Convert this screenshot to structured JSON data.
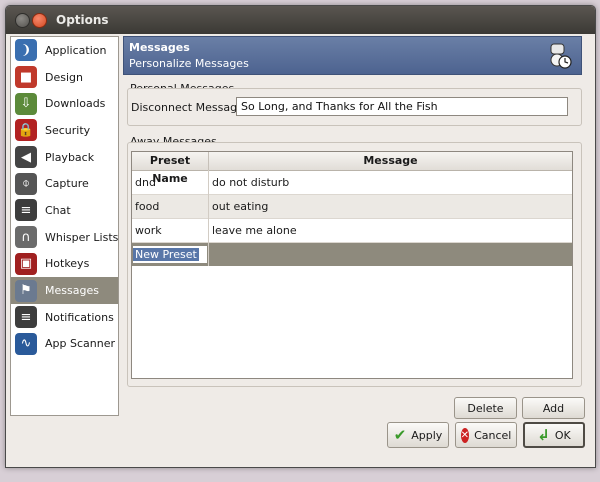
{
  "window": {
    "title": "Options"
  },
  "sidebar": {
    "items": [
      {
        "label": "Application",
        "icon": "teamspeak-icon",
        "color": "#3a6fb0",
        "glyph": "❩"
      },
      {
        "label": "Design",
        "icon": "palette-icon",
        "color": "#c0392b",
        "glyph": "■"
      },
      {
        "label": "Downloads",
        "icon": "download-icon",
        "color": "#5c8a3a",
        "glyph": "⇩"
      },
      {
        "label": "Security",
        "icon": "lock-icon",
        "color": "#b22222",
        "glyph": "🔒"
      },
      {
        "label": "Playback",
        "icon": "speaker-icon",
        "color": "#444444",
        "glyph": "◀"
      },
      {
        "label": "Capture",
        "icon": "microphone-icon",
        "color": "#555555",
        "glyph": "⌽"
      },
      {
        "label": "Chat",
        "icon": "chat-icon",
        "color": "#3d3d3d",
        "glyph": "≡"
      },
      {
        "label": "Whisper Lists",
        "icon": "headset-icon",
        "color": "#6b6b6b",
        "glyph": "∩"
      },
      {
        "label": "Hotkeys",
        "icon": "keyboard-icon",
        "color": "#a02020",
        "glyph": "▣"
      },
      {
        "label": "Messages",
        "icon": "messages-icon",
        "color": "#6b7a90",
        "glyph": "⚑"
      },
      {
        "label": "Notifications",
        "icon": "notification-icon",
        "color": "#3d3d3d",
        "glyph": "≡"
      },
      {
        "label": "App Scanner",
        "icon": "scanner-icon",
        "color": "#2a5a9a",
        "glyph": "∿"
      }
    ],
    "selected_index": 9
  },
  "header": {
    "title": "Messages",
    "subtitle": "Personalize Messages"
  },
  "personal": {
    "group_label": "Personal Messages",
    "disconnect_label": "Disconnect Message:",
    "disconnect_value": "So Long, and Thanks for All the Fish"
  },
  "away": {
    "group_label": "Away Messages",
    "columns": [
      "Preset Name",
      "Message"
    ],
    "rows": [
      {
        "name": "dnd",
        "message": "do not disturb"
      },
      {
        "name": "food",
        "message": "out eating"
      },
      {
        "name": "work",
        "message": "leave me alone"
      }
    ],
    "new_row": "New Preset"
  },
  "buttons": {
    "delete": "Delete",
    "add": "Add",
    "apply": "Apply",
    "cancel": "Cancel",
    "ok": "OK"
  },
  "colors": {
    "selection": "#8e8a7d",
    "header_blue": "#5b6f9a",
    "apply_check": "#3a9a2a",
    "cancel_x": "#cc2222"
  }
}
